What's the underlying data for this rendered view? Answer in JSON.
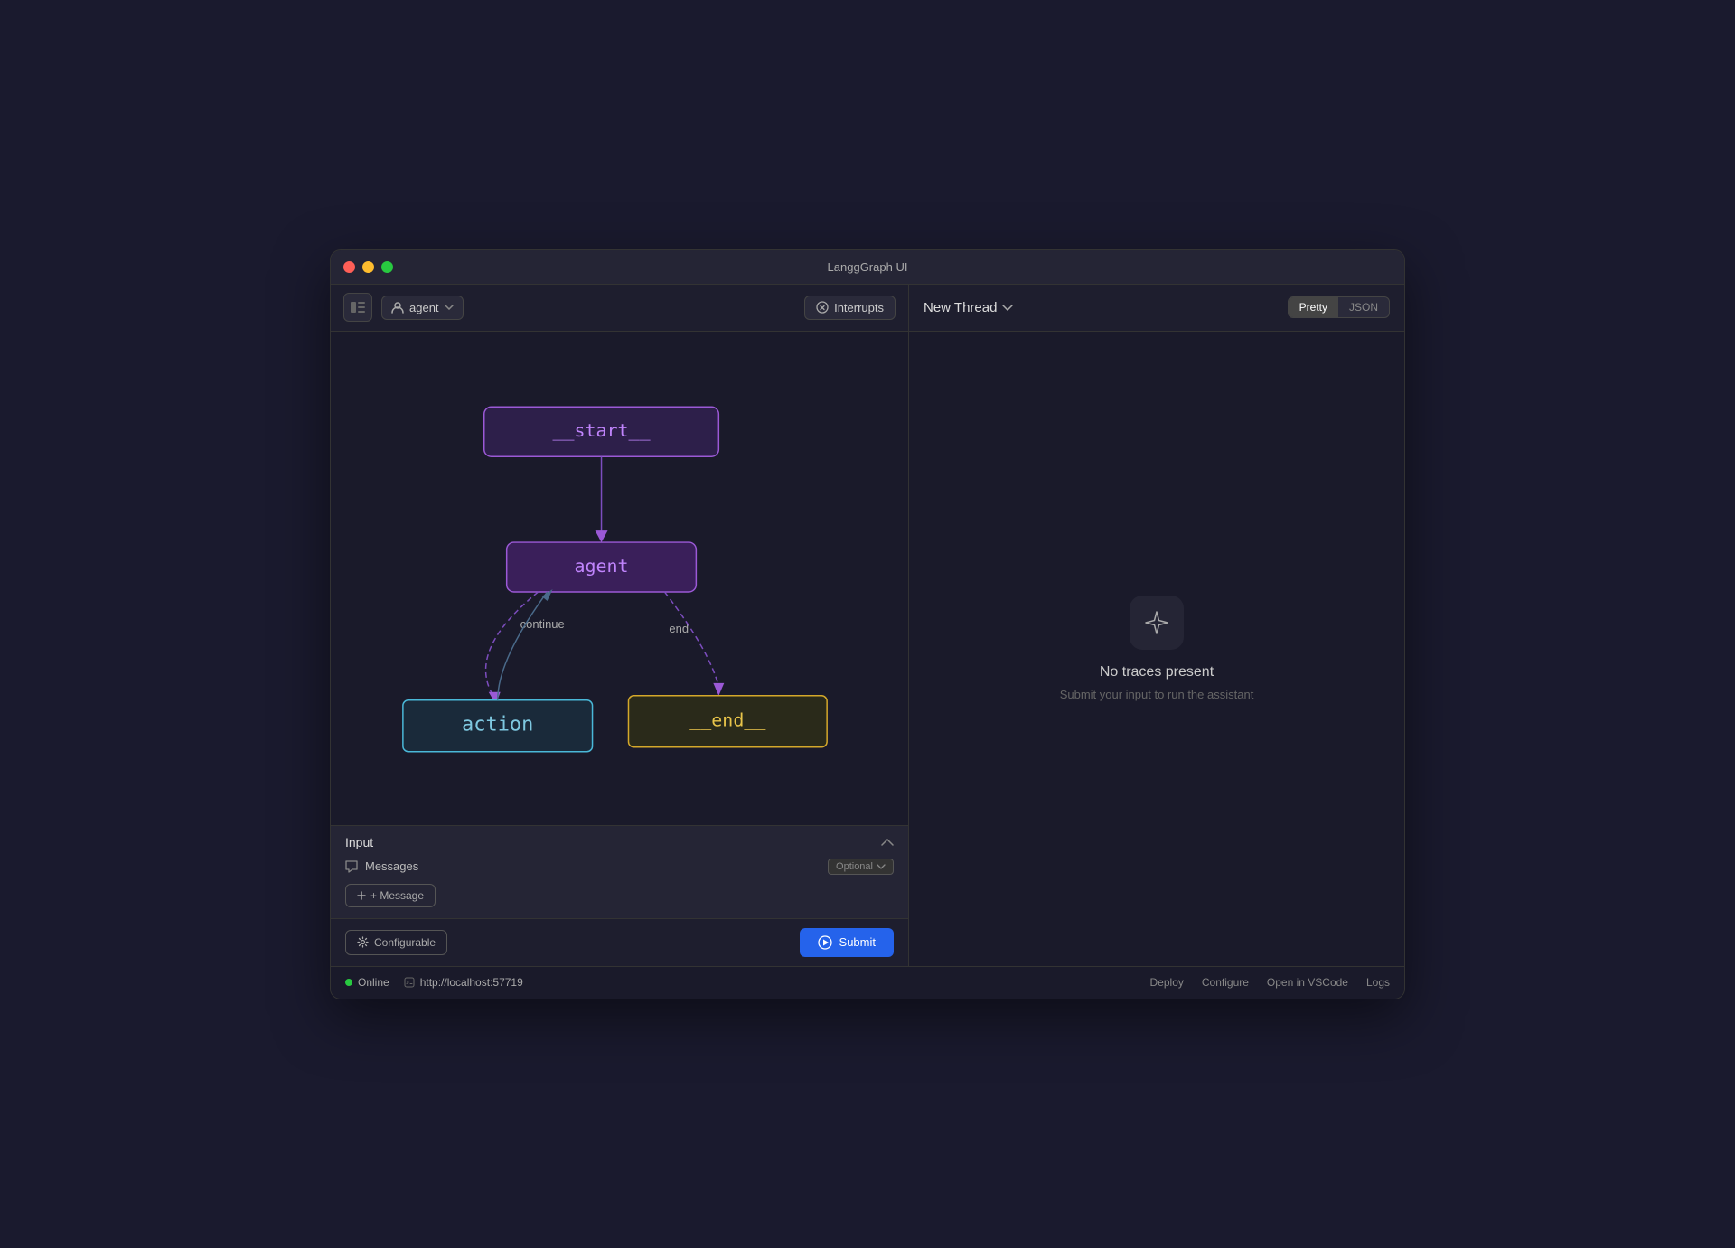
{
  "window": {
    "title": "LanggGraph UI"
  },
  "titlebar": {
    "title": "LanggGraph UI"
  },
  "left_toolbar": {
    "agent_label": "agent",
    "interrupts_label": "Interrupts"
  },
  "graph": {
    "nodes": {
      "start": "__start__",
      "agent": "agent",
      "action": "action",
      "end": "__end__"
    },
    "edge_labels": {
      "continue": "continue",
      "end": "end"
    }
  },
  "input_panel": {
    "title": "Input",
    "messages_label": "Messages",
    "optional_label": "Optional",
    "add_message_label": "+ Message",
    "configurable_label": "Configurable",
    "submit_label": "Submit"
  },
  "right_panel": {
    "new_thread_label": "New Thread",
    "pretty_label": "Pretty",
    "json_label": "JSON",
    "empty_title": "No traces present",
    "empty_subtitle": "Submit your input to run the assistant"
  },
  "statusbar": {
    "online_label": "Online",
    "url": "http://localhost:57719",
    "links": [
      "Deploy",
      "Configure",
      "Open in VSCode",
      "Logs"
    ]
  }
}
